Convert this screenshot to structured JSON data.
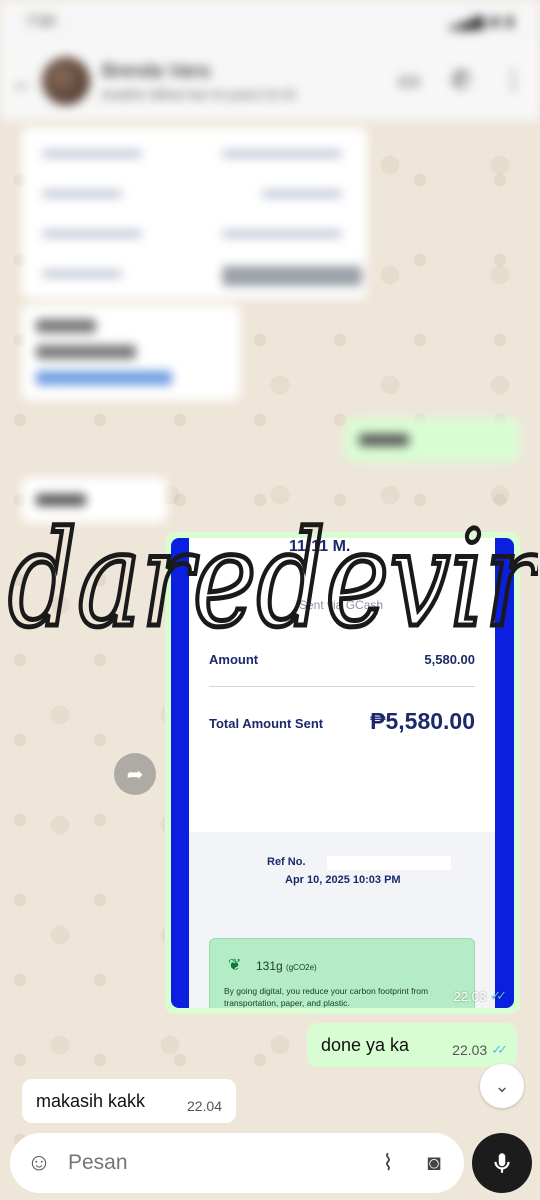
{
  "status_bar": {
    "time": "7:50",
    "icons": "signal-wifi-battery"
  },
  "header": {
    "contact_name": "Brenda Vans",
    "contact_status": "terakhir dilihat hari ini pukul 22.03"
  },
  "receipt": {
    "top_text": "11:11 M.",
    "sent_via": "Sent via GCash",
    "amount_label": "Amount",
    "amount_value": "5,580.00",
    "total_label": "Total Amount Sent",
    "total_value": "₱5,580.00",
    "ref_label": "Ref No.",
    "date": "Apr 10, 2025 10:03 PM",
    "co2_value": "131g",
    "co2_unit": "(gCO2e)",
    "digital_note": "By going digital, you reduce your carbon footprint from transportation, paper, and plastic."
  },
  "watermark": "daredevir",
  "messages": {
    "image_time": "22.03",
    "outgoing_text": "done ya ka",
    "outgoing_time": "22.03",
    "incoming_text": "makasih kakk",
    "incoming_time": "22.04"
  },
  "composer": {
    "placeholder": "Pesan"
  },
  "colors": {
    "outgoing_bubble": "#d9fdd3",
    "incoming_bubble": "#ffffff",
    "read_ticks": "#53bdeb",
    "receipt_border": "#0a1fe0"
  }
}
